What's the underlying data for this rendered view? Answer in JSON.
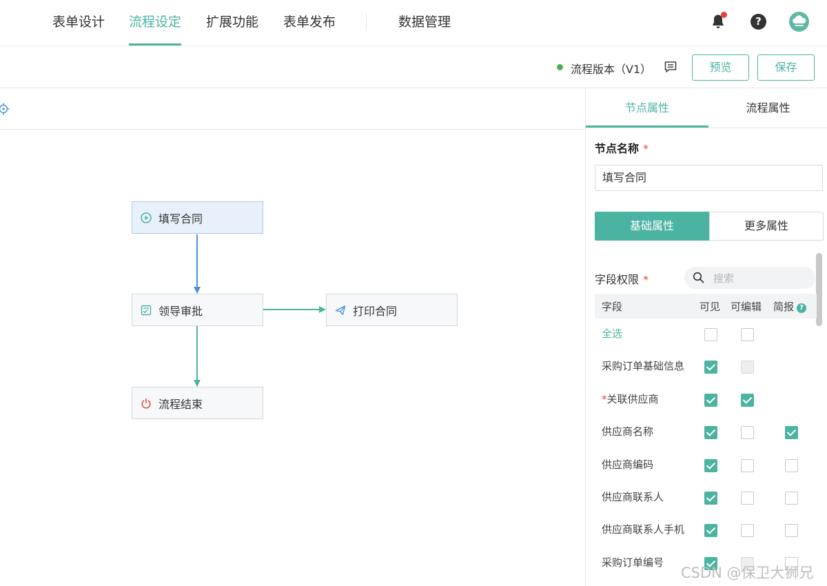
{
  "topnav": {
    "tabs": [
      {
        "label": "表单设计",
        "active": false
      },
      {
        "label": "流程设定",
        "active": true
      },
      {
        "label": "扩展功能",
        "active": false
      },
      {
        "label": "表单发布",
        "active": false
      },
      {
        "label": "数据管理",
        "active": false
      }
    ],
    "icons": [
      "bell-icon",
      "help-icon",
      "avatar"
    ],
    "accent_color": "#4bb3a2",
    "notification_dot_color": "#e8433a"
  },
  "toolbar": {
    "version_label": "流程版本（V1）",
    "status_color": "#4caf50",
    "preview_label": "预览",
    "save_label": "保存"
  },
  "canvas": {
    "nodes": [
      {
        "label": "填写合同",
        "icon": "play-circle-icon"
      },
      {
        "label": "领导审批",
        "icon": "approval-icon"
      },
      {
        "label": "打印合同",
        "icon": "send-icon"
      },
      {
        "label": "流程结束",
        "icon": "power-icon"
      }
    ]
  },
  "panel": {
    "tabs": [
      {
        "label": "节点属性",
        "active": true
      },
      {
        "label": "流程属性",
        "active": false
      }
    ],
    "node_name_label": "节点名称",
    "node_name_value": "填写合同",
    "segments": [
      {
        "label": "基础属性",
        "active": true
      },
      {
        "label": "更多属性",
        "active": false
      }
    ],
    "field_perm_label": "字段权限",
    "search_placeholder": "搜索",
    "columns": [
      "字段",
      "可见",
      "可编辑",
      "简报"
    ],
    "rows": [
      {
        "name": "全选",
        "link": true,
        "visible": "unchecked",
        "editable": "unchecked",
        "brief": "none"
      },
      {
        "name": "采购订单基础信息",
        "visible": "checked",
        "editable": "disabled",
        "brief": "none"
      },
      {
        "name": "关联供应商",
        "required": true,
        "visible": "checked",
        "editable": "checked",
        "brief": "none"
      },
      {
        "name": "供应商名称",
        "visible": "checked",
        "editable": "unchecked",
        "brief": "checked"
      },
      {
        "name": "供应商编码",
        "visible": "checked",
        "editable": "unchecked",
        "brief": "unchecked"
      },
      {
        "name": "供应商联系人",
        "visible": "checked",
        "editable": "unchecked",
        "brief": "unchecked"
      },
      {
        "name": "供应商联系人手机",
        "visible": "checked",
        "editable": "unchecked",
        "brief": "unchecked"
      },
      {
        "name": "采购订单编号",
        "visible": "checked",
        "editable": "disabled",
        "brief": "unchecked"
      }
    ]
  },
  "watermark": "CSDN @保卫大狮兄"
}
